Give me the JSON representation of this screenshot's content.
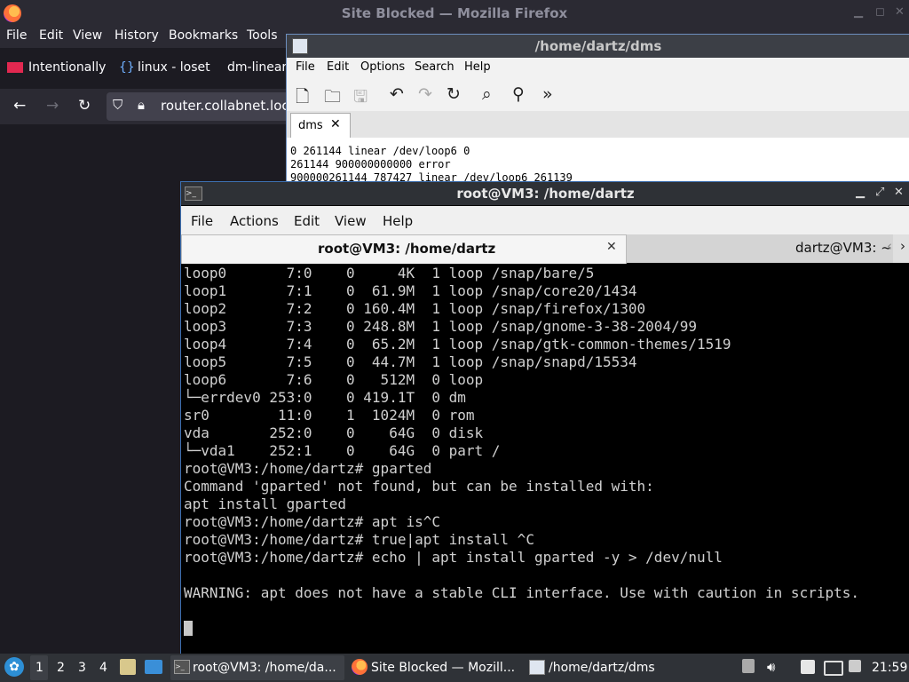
{
  "firefox": {
    "title": "Site Blocked — Mozilla Firefox",
    "menus": [
      "File",
      "Edit",
      "View",
      "History",
      "Bookmarks",
      "Tools"
    ],
    "tabs": [
      "Intentionally",
      "linux - loset",
      "dm-linear"
    ],
    "url": "router.collabnet.local"
  },
  "dms": {
    "title": "/home/dartz/dms",
    "menus": [
      "File",
      "Edit",
      "Options",
      "Search",
      "Help"
    ],
    "tab_label": "dms",
    "lines": [
      "0 261144 linear /dev/loop6 0",
      "261144 900000000000 error",
      "900000261144 787427 linear /dev/loop6 261139"
    ]
  },
  "terminal": {
    "title": "root@VM3: /home/dartz",
    "menus": [
      "File",
      "Actions",
      "Edit",
      "View",
      "Help"
    ],
    "tabs": [
      "root@VM3: /home/dartz",
      "dartz@VM3: ~"
    ],
    "lines": [
      "loop0       7:0    0     4K  1 loop /snap/bare/5",
      "loop1       7:1    0  61.9M  1 loop /snap/core20/1434",
      "loop2       7:2    0 160.4M  1 loop /snap/firefox/1300",
      "loop3       7:3    0 248.8M  1 loop /snap/gnome-3-38-2004/99",
      "loop4       7:4    0  65.2M  1 loop /snap/gtk-common-themes/1519",
      "loop5       7:5    0  44.7M  1 loop /snap/snapd/15534",
      "loop6       7:6    0   512M  0 loop",
      "└─errdev0 253:0    0 419.1T  0 dm",
      "sr0        11:0    1  1024M  0 rom",
      "vda       252:0    0    64G  0 disk",
      "└─vda1    252:1    0    64G  0 part /",
      "root@VM3:/home/dartz# gparted",
      "Command 'gparted' not found, but can be installed with:",
      "apt install gparted",
      "root@VM3:/home/dartz# apt is^C",
      "root@VM3:/home/dartz# true|apt install ^C",
      "root@VM3:/home/dartz# echo | apt install gparted -y > /dev/null",
      "",
      "WARNING: apt does not have a stable CLI interface. Use with caution in scripts.",
      ""
    ]
  },
  "taskbar": {
    "workspaces": [
      "1",
      "2",
      "3",
      "4"
    ],
    "tasks": [
      "root@VM3: /home/da...",
      "Site Blocked — Mozill...",
      "/home/dartz/dms"
    ],
    "clock": "21:59"
  }
}
